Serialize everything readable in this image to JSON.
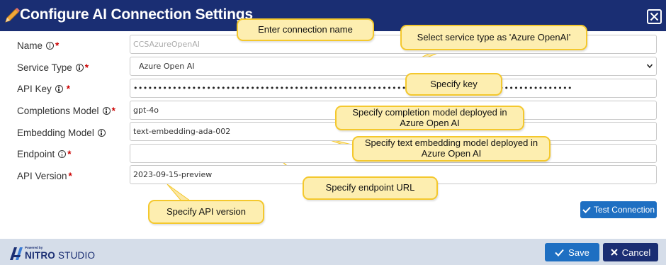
{
  "dialog": {
    "title": "Configure AI Connection Settings"
  },
  "form": {
    "name_label": "Name",
    "name_placeholder": "CCSAzureOpenAI",
    "service_type_label": "Service Type",
    "service_type_value": "Azure Open AI",
    "api_key_label": "API Key",
    "api_key_value": "••••••••••••••••••••••••••••••••••••••••••••••••••••••••••••••••••••••••••••••••••••••••••",
    "completions_model_label": "Completions Model",
    "completions_model_value": "gpt-4o",
    "embedding_model_label": "Embedding Model",
    "embedding_model_value": "text-embedding-ada-002",
    "endpoint_label": "Endpoint",
    "endpoint_value": "",
    "api_version_label": "API Version",
    "api_version_value": "2023-09-15-preview",
    "required_mark": "*"
  },
  "callouts": {
    "name": "Enter connection name",
    "service_type": "Select service type as 'Azure OpenAI'",
    "key": "Specify key",
    "completion_line1": "Specify completion model deployed in",
    "completion_line2": "Azure Open AI",
    "embedding_line1": "Specify text embedding model deployed in",
    "embedding_line2": "Azure Open AI",
    "endpoint": "Specify endpoint URL",
    "api_version": "Specify API version"
  },
  "buttons": {
    "test_connection": "Test Connection",
    "save": "Save",
    "cancel": "Cancel"
  },
  "footer": {
    "powered_by": "Powered by",
    "brand_name": "NITRO",
    "brand_suffix": " STUDIO"
  },
  "colors": {
    "header": "#1a2e73",
    "primary_button": "#1e6fc2",
    "cancel_button": "#1a2e73",
    "footer": "#d5dde9",
    "callout_fill": "#fdeeb0",
    "callout_border": "#f4c82d",
    "required": "#cc0000"
  },
  "icons": {
    "title": "pencil-icon",
    "close": "close-icon",
    "info": "info-icon",
    "select": "chevron-down-icon",
    "check": "check-icon",
    "cancel": "x-icon",
    "logo": "nitro-logo-icon"
  }
}
